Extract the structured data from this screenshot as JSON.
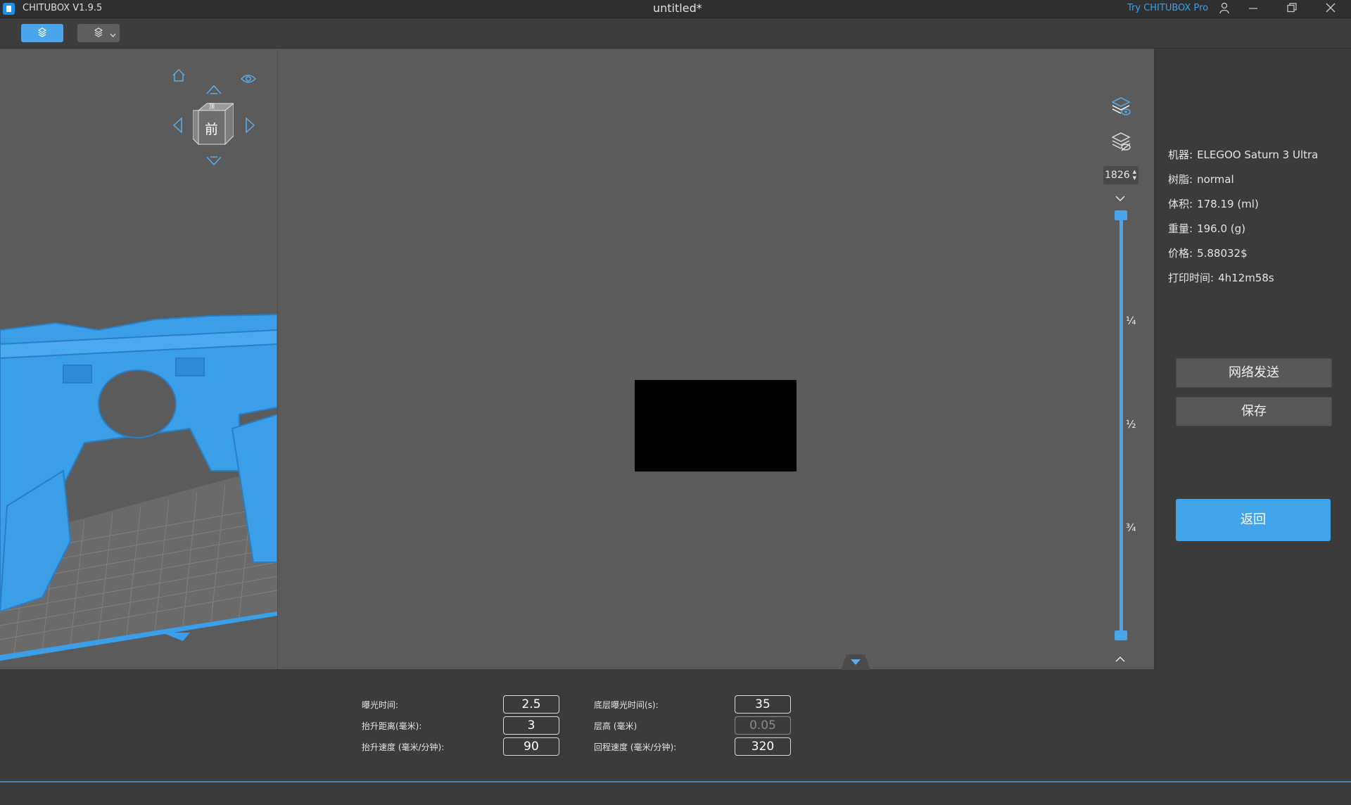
{
  "titlebar": {
    "app_name": "CHITUBOX V1.9.5",
    "document": "untitled*",
    "try_pro": "Try CHITUBOX Pro",
    "icons": [
      "user-icon",
      "minimize-icon",
      "restore-icon",
      "close-icon"
    ]
  },
  "toolbar": {
    "icons": [
      "slice-view-icon",
      "print-view-icon",
      "chevron-down-icon"
    ]
  },
  "viewcube": {
    "face": "前",
    "top_face": "顶",
    "icons": [
      "home-icon",
      "eye-icon",
      "arrow-up-icon",
      "arrow-down-icon",
      "arrow-left-icon",
      "arrow-right-icon"
    ]
  },
  "layers": {
    "current": "1826",
    "ticks": [
      "¼",
      "½",
      "¾"
    ]
  },
  "info": {
    "machine_label": "机器:",
    "machine": "ELEGOO Saturn 3 Ultra",
    "resin_label": "树脂:",
    "resin": "normal",
    "volume_label": "体积:",
    "volume": "178.19  (ml)",
    "weight_label": "重量:",
    "weight": "196.0  (g)",
    "price_label": "价格:",
    "price": "5.88032$",
    "time_label": "打印时间:",
    "time": "4h12m58s"
  },
  "actions": {
    "network_send": "网络发送",
    "save": "保存",
    "back": "返回"
  },
  "params": {
    "exposure_label": "曝光时间:",
    "exposure": "2.5",
    "bottom_exposure_label": "底层曝光时间(s):",
    "bottom_exposure": "35",
    "lift_distance_label": "抬升距离(毫米):",
    "lift_distance": "3",
    "layer_height_label": "层高 (毫米)",
    "layer_height": "0.05",
    "lift_speed_label": "抬升速度 (毫米/分钟):",
    "lift_speed": "90",
    "retract_speed_label": "回程速度 (毫米/分钟):",
    "retract_speed": "320"
  },
  "colors": {
    "accent": "#4aa6ea",
    "model": "#3a9ee8",
    "viewport": "#5b5b5b"
  }
}
